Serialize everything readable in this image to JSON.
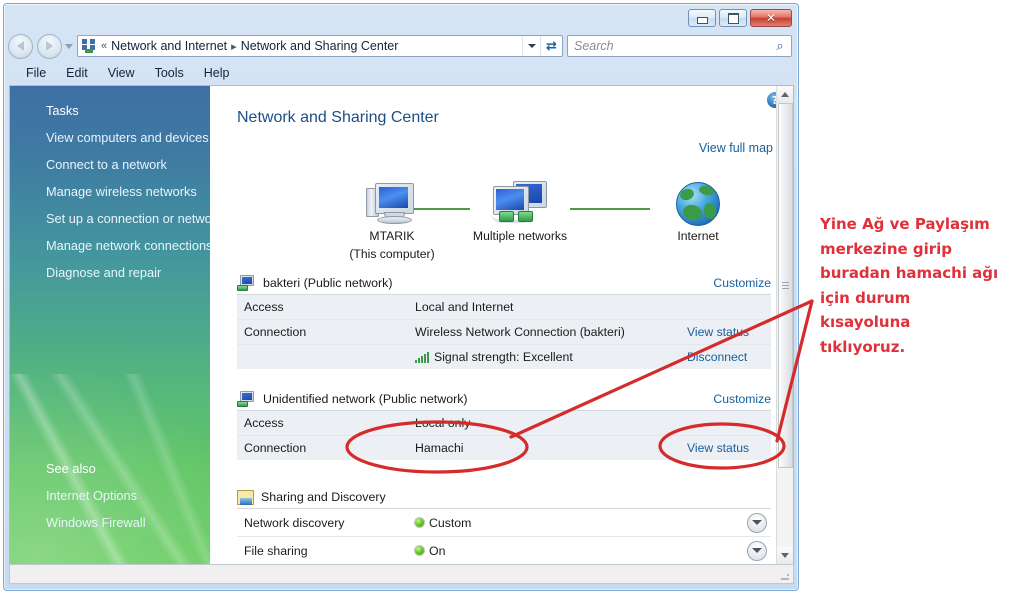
{
  "window": {
    "controls": {
      "minimize": "Minimize",
      "maximize": "Maximize",
      "close": "✕"
    },
    "address": {
      "icon": "network-icon",
      "separator_leading": "«",
      "crumbs": [
        "Network and Internet",
        "Network and Sharing Center"
      ],
      "crumb_separator": "▸",
      "dropdown": "▾",
      "refresh": "↻"
    },
    "search": {
      "placeholder": "Search",
      "value": "",
      "icon": "search-icon"
    },
    "menu": [
      "File",
      "Edit",
      "View",
      "Tools",
      "Help"
    ]
  },
  "sidebar": {
    "tasks_heading": "Tasks",
    "tasks": [
      "View computers and devices",
      "Connect to a network",
      "Manage wireless networks",
      "Set up a connection or network",
      "Manage network connections",
      "Diagnose and repair"
    ],
    "see_also_heading": "See also",
    "see_also": [
      "Internet Options",
      "Windows Firewall"
    ]
  },
  "content": {
    "help_glyph": "?",
    "page_title": "Network and Sharing Center",
    "view_full_map": "View full map",
    "map": {
      "nodes": [
        {
          "icon": "computer-icon",
          "label": "MTARIK",
          "sublabel": "(This computer)"
        },
        {
          "icon": "multiple-networks-icon",
          "label": "Multiple networks",
          "sublabel": ""
        },
        {
          "icon": "globe-icon",
          "label": "Internet",
          "sublabel": ""
        }
      ]
    },
    "networks": [
      {
        "icon": "network-computer-icon",
        "title": "bakteri (Public network)",
        "customize": "Customize",
        "rows": [
          {
            "label": "Access",
            "value": "Local and Internet",
            "link": ""
          },
          {
            "label": "Connection",
            "value": "Wireless Network Connection (bakteri)",
            "link": "View status"
          },
          {
            "label": "",
            "value": "Signal strength:  Excellent",
            "icon": "signal-strength-icon",
            "link": "Disconnect"
          }
        ]
      },
      {
        "icon": "network-computer-icon",
        "title": "Unidentified network (Public network)",
        "customize": "Customize",
        "rows": [
          {
            "label": "Access",
            "value": "Local only",
            "link": ""
          },
          {
            "label": "Connection",
            "value": "Hamachi",
            "link": "View status"
          }
        ]
      }
    ],
    "sharing": {
      "icon": "sharing-icon",
      "title": "Sharing and Discovery",
      "rows": [
        {
          "label": "Network discovery",
          "status": "Custom",
          "dot": "status-dot-green",
          "expander": "chevron-down-icon"
        },
        {
          "label": "File sharing",
          "status": "On",
          "dot": "status-dot-green",
          "expander": "chevron-down-icon"
        }
      ]
    }
  },
  "annotation": {
    "color": "#e0303a",
    "lines": [
      "Yine Ağ ve Paylaşım",
      "merkezine girip",
      "buradan hamachi ağı",
      "için durum",
      "kısayoluna",
      "tıklıyoruz."
    ],
    "highlights": [
      "Hamachi",
      "View status"
    ]
  },
  "colors": {
    "accent_link": "#16609e",
    "title_blue": "#1b4f85",
    "sidebar_top": "#3e6fa4",
    "sidebar_bottom": "#6bcd64",
    "annotation_red": "#e0303a",
    "status_green": "#6ec832"
  }
}
